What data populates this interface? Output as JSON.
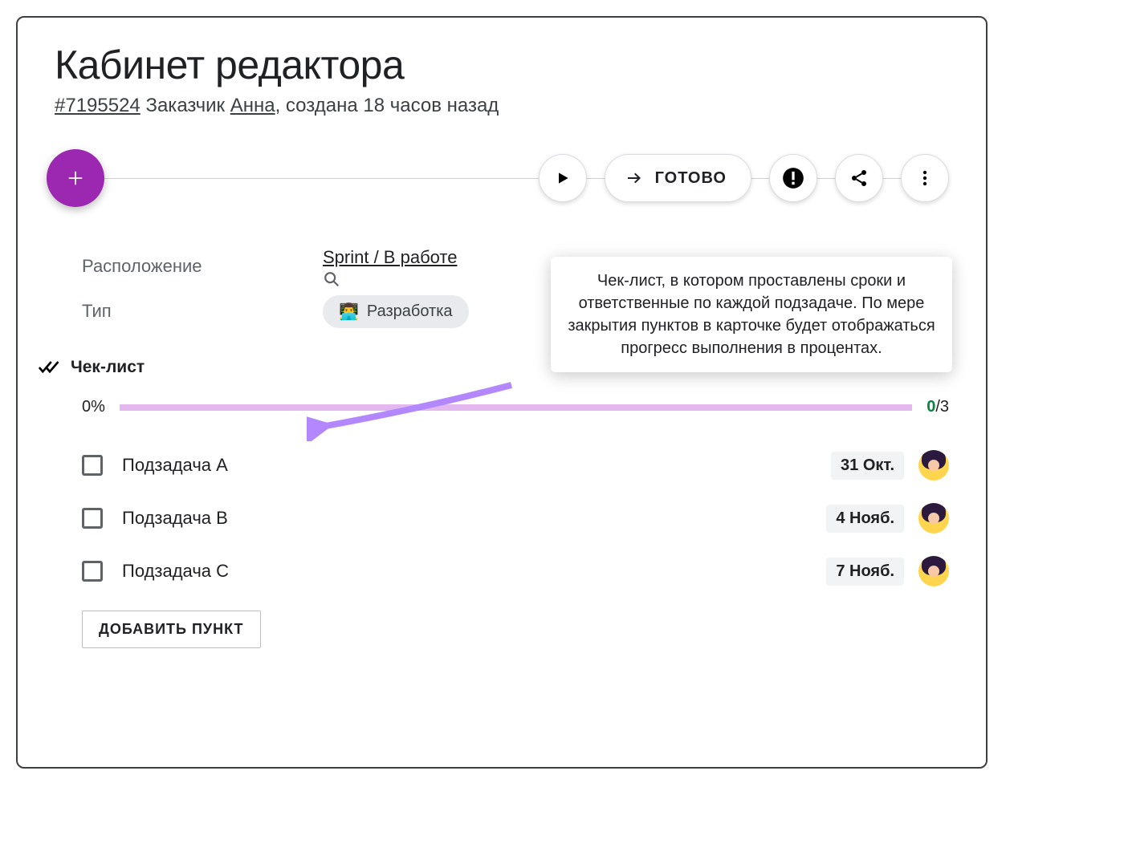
{
  "title": "Кабинет редактора",
  "subtitle": {
    "ticket": "#7195524",
    "client_label": "Заказчик",
    "client_name": "Анна",
    "created": ", создана 18 часов назад"
  },
  "toolbar": {
    "done_label": "ГОТОВО"
  },
  "fields": {
    "location_label": "Расположение",
    "location_value": "Sprint / В работе",
    "type_label": "Тип",
    "type_emoji": "👨‍💻",
    "type_value": "Разработка"
  },
  "callout": "Чек-лист, в котором проставлены сроки и ответственные по каждой подзадаче. По мере закрытия пунктов в карточке будет отображаться прогресс выполнения в процентах.",
  "checklist": {
    "title": "Чек-лист",
    "percent": "0%",
    "done": "0",
    "total": "/3",
    "items": [
      {
        "label": "Подзадача A",
        "date": "31 Окт."
      },
      {
        "label": "Подзадача B",
        "date": "4 Нояб."
      },
      {
        "label": "Подзадача C",
        "date": "7 Нояб."
      }
    ],
    "add_label": "ДОБАВИТЬ ПУНКТ"
  },
  "colors": {
    "accent": "#9c27b0",
    "arrow": "#b388ff",
    "progress_bar": "#e2b8ef",
    "done_green": "#0b8043"
  }
}
